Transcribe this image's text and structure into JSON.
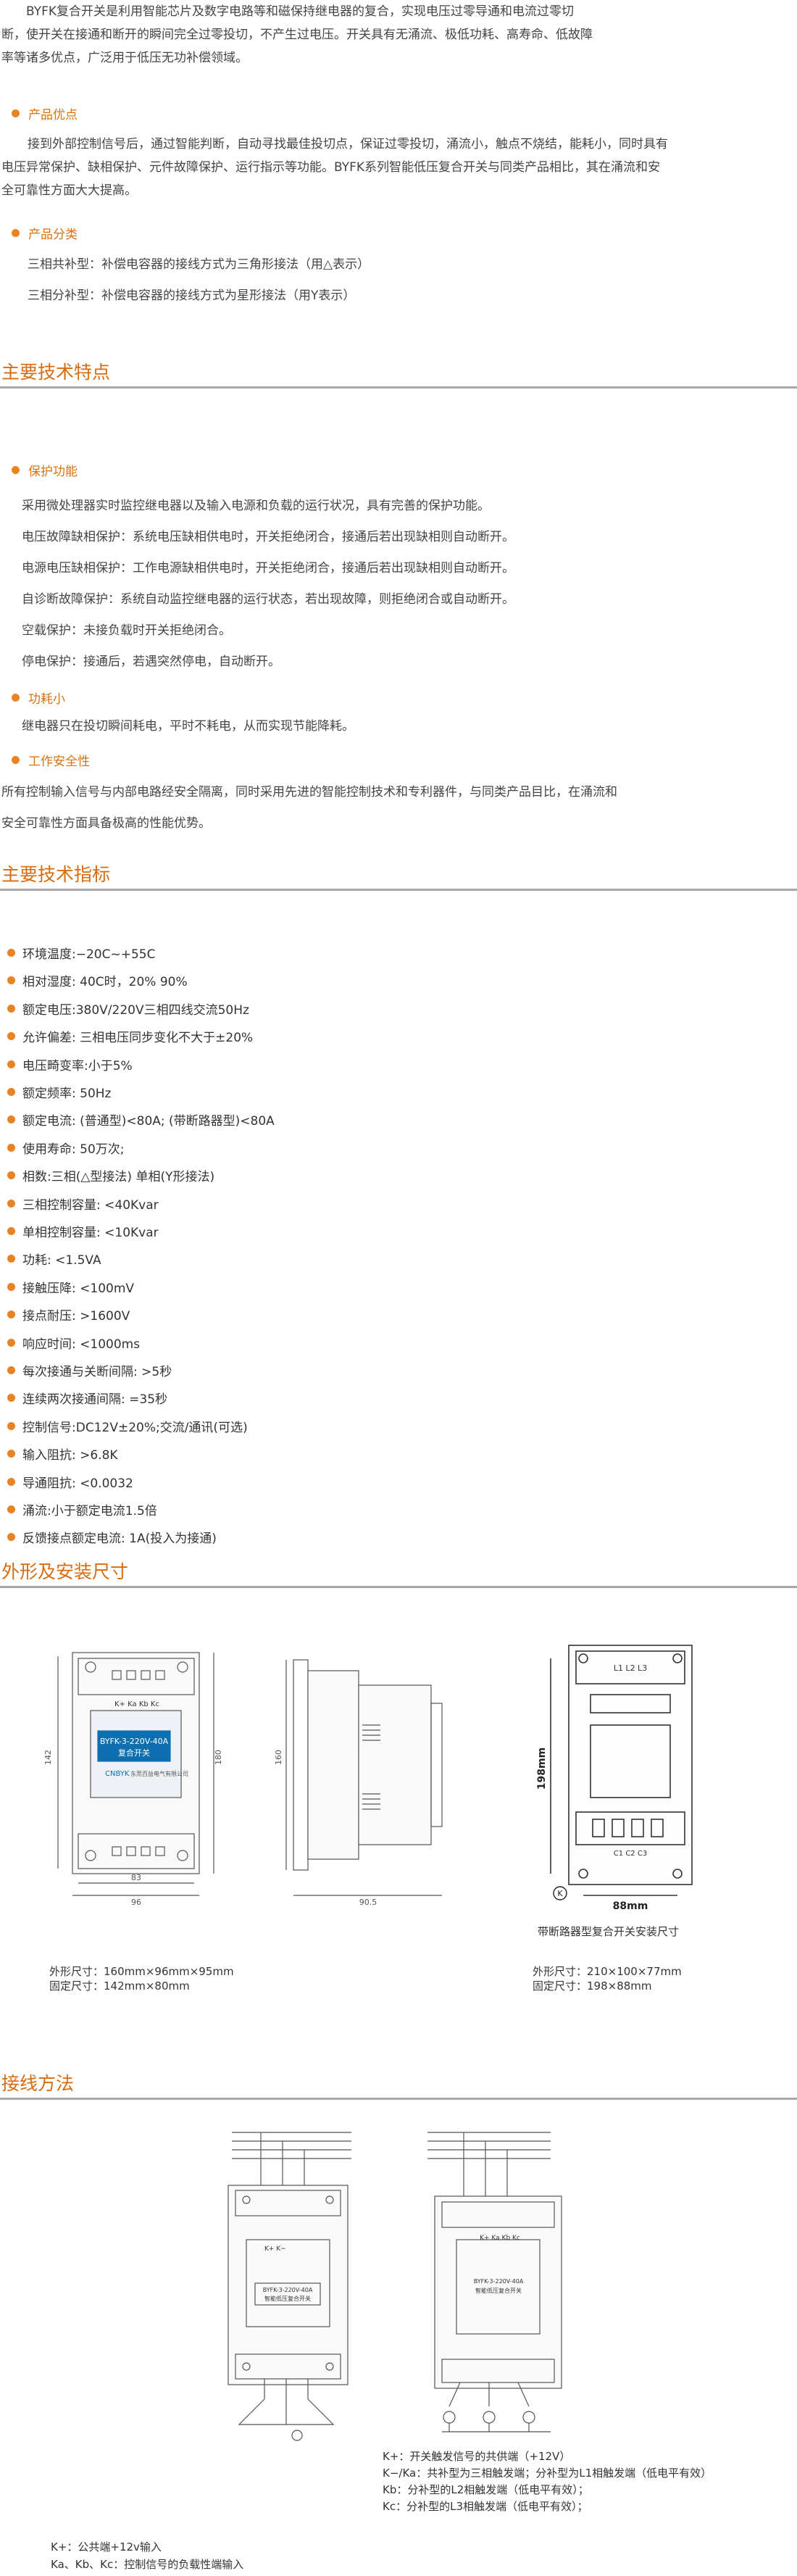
{
  "intro": {
    "line1": "BYFK复合开关是利用智能芯片及数字电路等和磁保持继电器的复合，实现电压过零导通和电流过零切",
    "line2": "断，使开关在接通和断开的瞬间完全过零投切，不产生过电压。开关具有无涌流、极低功耗、高寿命、低故障",
    "line3": "率等诸多优点，广泛用于低压无功补偿领域。"
  },
  "advantages": {
    "title": "产品优点",
    "line1": "接到外部控制信号后，通过智能判断，自动寻找最佳投切点，保证过零投切，涌流小，触点不烧结，能耗小，同时具有",
    "line2": "电压异常保护、缺相保护、元件故障保护、运行指示等功能。BYFK系列智能低压复合开关与同类产品相比，其在涌流和安",
    "line3": "全可靠性方面大大提高。"
  },
  "categories": {
    "title": "产品分类",
    "items": [
      "三相共补型：补偿电容器的接线方式为三角形接法（用△表示）",
      "三相分补型：补偿电容器的接线方式为星形接法（用Y表示）"
    ]
  },
  "features": {
    "title": "主要技术特点",
    "protection_title": "保护功能",
    "protection_items": [
      "采用微处理器实时监控继电器以及输入电源和负载的运行状况，具有完善的保护功能。",
      "电压故障缺相保护：系统电压缺相供电时，开关拒绝闭合，接通后若出现缺相则自动断开。",
      "电源电压缺相保护：工作电源缺相供电时，开关拒绝闭合，接通后若出现缺相则自动断开。",
      "自诊断故障保护：系统自动监控继电器的运行状态，若出现故障，则拒绝闭合或自动断开。",
      "空载保护：未接负载时开关拒绝闭合。",
      "停电保护：接通后，若遇突然停电，自动断开。"
    ],
    "power_title": "功耗小",
    "power_text": "继电器只在投切瞬间耗电，平时不耗电，从而实现节能降耗。",
    "safety_title": "工作安全性",
    "safety_line1": "所有控制输入信号与内部电路经安全隔离，同时采用先进的智能控制技术和专利器件，与同类产品目比，在涌流和",
    "safety_line2": "安全可靠性方面具备极高的性能优势。"
  },
  "specs": {
    "title": "主要技术指标",
    "items": [
      "环境温度:−20C~+55C",
      "相对湿度: 40C时，20% 90%",
      "额定电压:380V/220V三相四线交流50Hz",
      "允许偏差: 三相电压同步变化不大于±20%",
      "电压畸变率:小于5%",
      "额定频率: 50Hz",
      "额定电流: (普通型)<80A; (带断路器型)<80A",
      "使用寿命: 50万次;",
      "相数:三相(△型接法) 单相(Y形接法)",
      "三相控制容量: <40Kvar",
      "单相控制容量: <10Kvar",
      "功耗: <1.5VA",
      "接触压降: <100mV",
      "接点耐压: >1600V",
      "响应时间: <1000ms",
      "每次接通与关断间隔: >5秒",
      "连续两次接通间隔: =35秒",
      "控制信号:DC12V±20%;交流/通讯(可选)",
      "输入阻抗: >6.8K",
      "导通阻抗: <0.0032",
      "涌流:小于额定电流1.5倍",
      "反馈接点额定电流: 1A(投入为接通)"
    ]
  },
  "dimensions": {
    "title": "外形及安装尺寸",
    "left_caption1": "外形尺寸：160mm×96mm×95mm",
    "left_caption2": "固定尺寸：142mm×80mm",
    "right_label": "带断路器型复合开关安装尺寸",
    "right_caption1": "外形尺寸：210×100×77mm",
    "right_caption2": "固定尺寸：198×88mm",
    "drawing": {
      "front_label_model": "BYFK-3-220V-40A",
      "front_label_name": "复合开关",
      "front_brand": "CNBYK",
      "front_company": "东莞百益电气有限公司",
      "terminal_label": "K+ Ka Kb Kc",
      "dim_142": "142",
      "dim_180": "180",
      "dim_160": "160",
      "dim_83": "83",
      "dim_96": "96",
      "dim_90_5": "90.5",
      "dim_198": "198mm",
      "dim_88": "88mm",
      "breaker_labels": "L1 L2 L3",
      "breaker_out": "C1 C2 C3",
      "k_mark": "K"
    }
  },
  "wiring": {
    "title": "接线方法",
    "left_legend1": "K+：公共端+12v输入",
    "left_legend2": "Ka、Kb、Kc：控制信号的负载性端输入",
    "right_legend1": "K+：开关触发信号的共供端（+12V）",
    "right_legend2": "K−/Ka：共补型为三相触发端；分补型为L1相触发端（低电平有效）",
    "right_legend3": "Kb：分补型的L2相触发端（低电平有效）；",
    "right_legend4": "Kc：分补型的L3相触发端（低电平有效）；",
    "device_label": "BYFK-3-220V-40A",
    "device_sub": "智能低压复合开关",
    "k_label": "K+ K−",
    "k_label2": "K+ Ka Kb Kc"
  },
  "colors": {
    "accent": "#d86c10",
    "dot": "#e98424",
    "rule": "#a8a8a8",
    "text": "#444444"
  }
}
